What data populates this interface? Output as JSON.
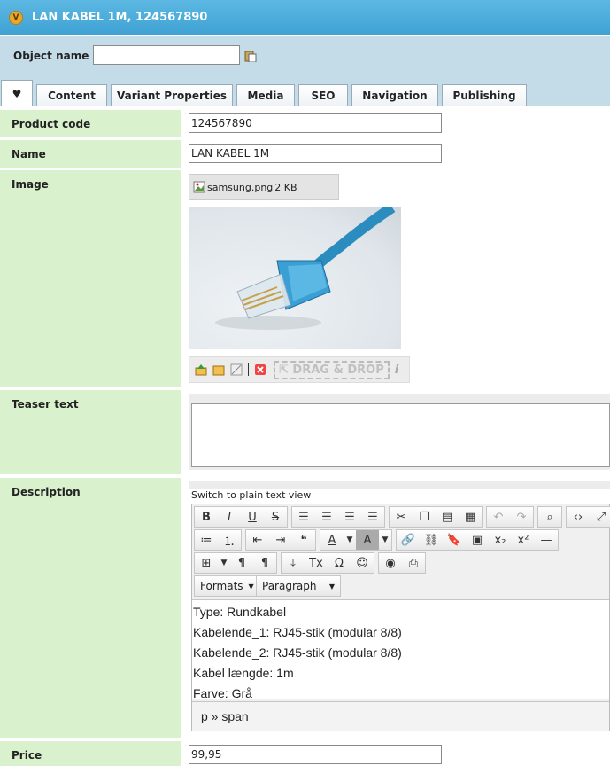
{
  "title": "LAN KABEL 1M, 124567890",
  "header": {
    "object_name_label": "Object name",
    "object_name_value": ""
  },
  "tabs": [
    {
      "label": "♥"
    },
    {
      "label": "Content"
    },
    {
      "label": "Variant Properties"
    },
    {
      "label": "Media"
    },
    {
      "label": "SEO"
    },
    {
      "label": "Navigation"
    },
    {
      "label": "Publishing"
    }
  ],
  "fields": {
    "product_code": {
      "label": "Product code",
      "value": "124567890"
    },
    "name": {
      "label": "Name",
      "value": "LAN KABEL 1M"
    },
    "image": {
      "label": "Image",
      "file_name": "samsung.png",
      "file_size": "2 KB",
      "drag_drop": "⇱ DRAG & DROP"
    },
    "teaser": {
      "label": "Teaser text",
      "value": ""
    },
    "description": {
      "label": "Description",
      "plain_link": "Switch to plain text view",
      "formats": "Formats",
      "paragraph": "Paragraph",
      "lines": [
        "Type: Rundkabel",
        "Kabelende_1: RJ45-stik (modular 8/8)",
        "Kabelende_2: RJ45-stik (modular 8/8)",
        "Kabel længde: 1m",
        "Farve: Grå"
      ],
      "status_path": "p » span"
    },
    "price": {
      "label": "Price",
      "value": "99,95"
    }
  }
}
